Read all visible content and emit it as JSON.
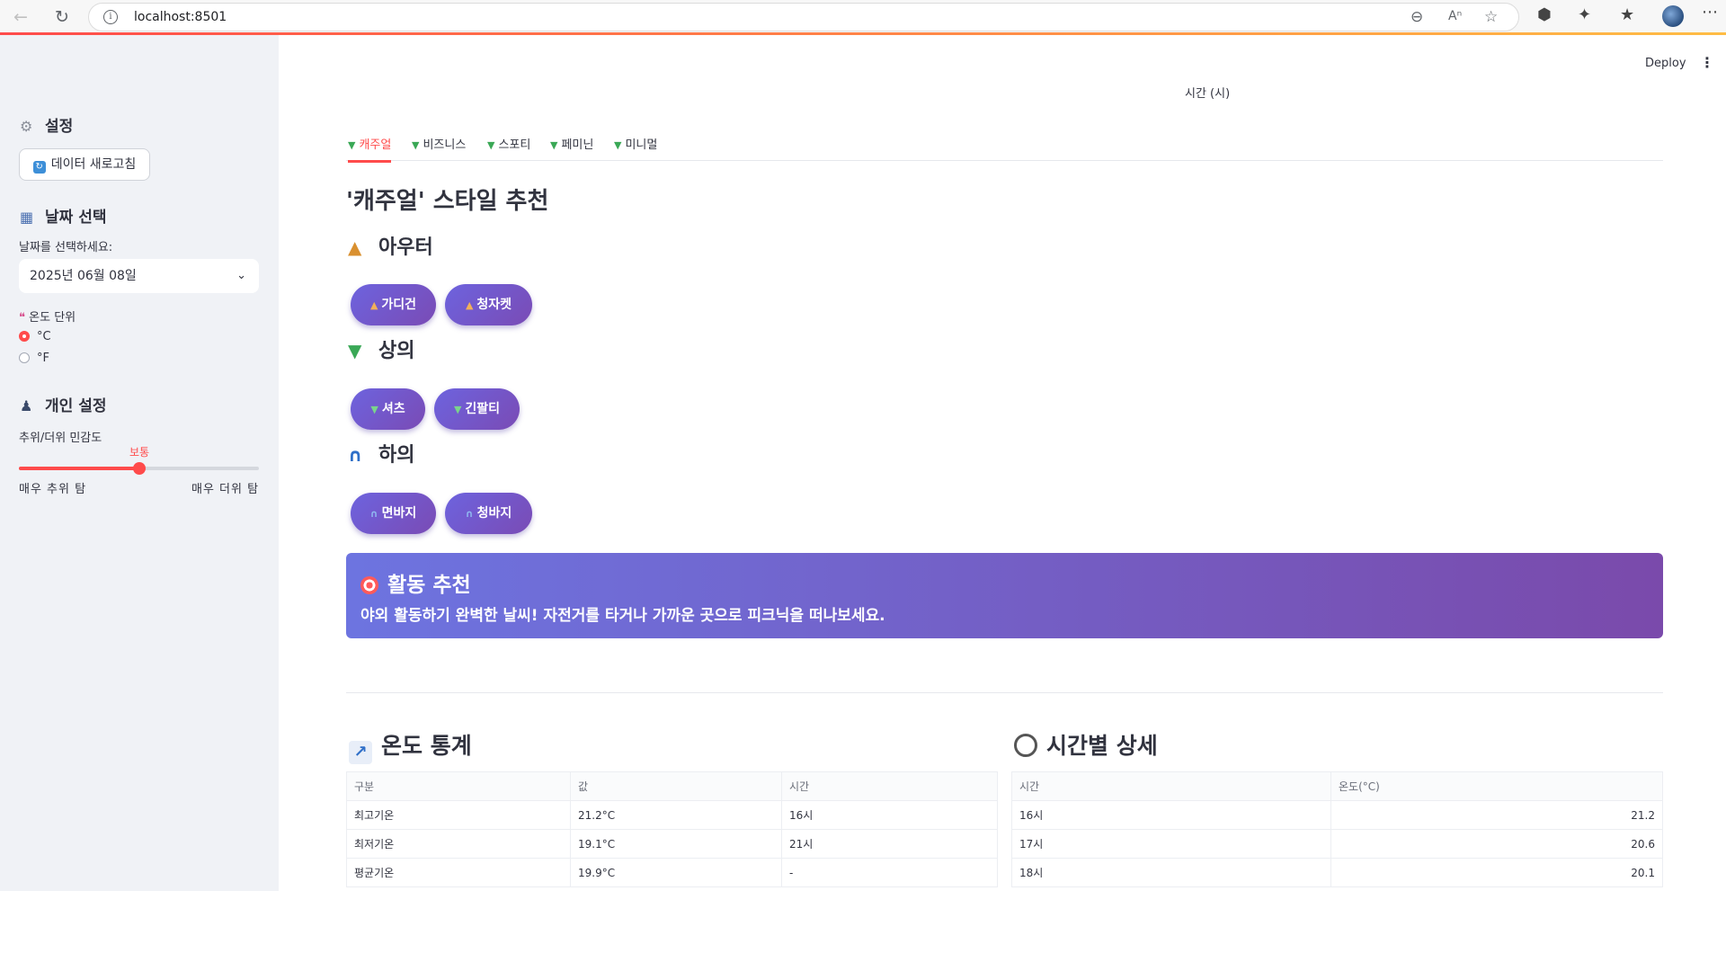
{
  "browser": {
    "url": "localhost:8501"
  },
  "header": {
    "deploy_label": "Deploy",
    "chart_axis_label": "시간 (시)"
  },
  "sidebar": {
    "settings_title": "설정",
    "refresh_button": "데이터 새로고침",
    "date_section_title": "날짜 선택",
    "date_prompt": "날짜를 선택하세요:",
    "date_value": "2025년 06월 08일",
    "temp_unit_label": "온도 단위",
    "temp_unit_options": [
      "°C",
      "°F"
    ],
    "temp_unit_selected": "°C",
    "personal_title": "개인 설정",
    "sensitivity_label": "추위/더위 민감도",
    "sensitivity_value_label": "보통",
    "sensitivity_level": 0.5,
    "sensitivity_min": "매우 추위 탐",
    "sensitivity_max": "매우 더위 탐"
  },
  "main": {
    "tabs": [
      "캐주얼",
      "비즈니스",
      "스포티",
      "페미닌",
      "미니멀"
    ],
    "active_tab": "캐주얼",
    "style_title": "'캐주얼' 스타일 추천",
    "sections": {
      "outer": {
        "title": "아우터",
        "items": [
          "가디건",
          "청자켓"
        ]
      },
      "top": {
        "title": "상의",
        "items": [
          "셔츠",
          "긴팔티"
        ]
      },
      "bottom": {
        "title": "하의",
        "items": [
          "면바지",
          "청바지"
        ]
      }
    },
    "activity": {
      "title": "활동 추천",
      "text": "야외 활동하기 완벽한 날씨! 자전거를 타거나 가까운 곳으로 피크닉을 떠나보세요."
    },
    "temp_stats": {
      "title": "온도 통계",
      "columns": [
        "구분",
        "값",
        "시간"
      ],
      "rows": [
        [
          "최고기온",
          "21.2°C",
          "16시"
        ],
        [
          "최저기온",
          "19.1°C",
          "21시"
        ],
        [
          "평균기온",
          "19.9°C",
          "-"
        ]
      ]
    },
    "hourly": {
      "title": "시간별 상세",
      "columns": [
        "시간",
        "온도(°C)"
      ],
      "rows": [
        [
          "16시",
          "21.2"
        ],
        [
          "17시",
          "20.6"
        ],
        [
          "18시",
          "20.1"
        ]
      ]
    }
  },
  "colors": {
    "accent": "#ff4b4b",
    "pill_gradient_start": "#6d63de",
    "pill_gradient_end": "#7a4bb5",
    "sidebar_bg": "#f0f2f6"
  }
}
